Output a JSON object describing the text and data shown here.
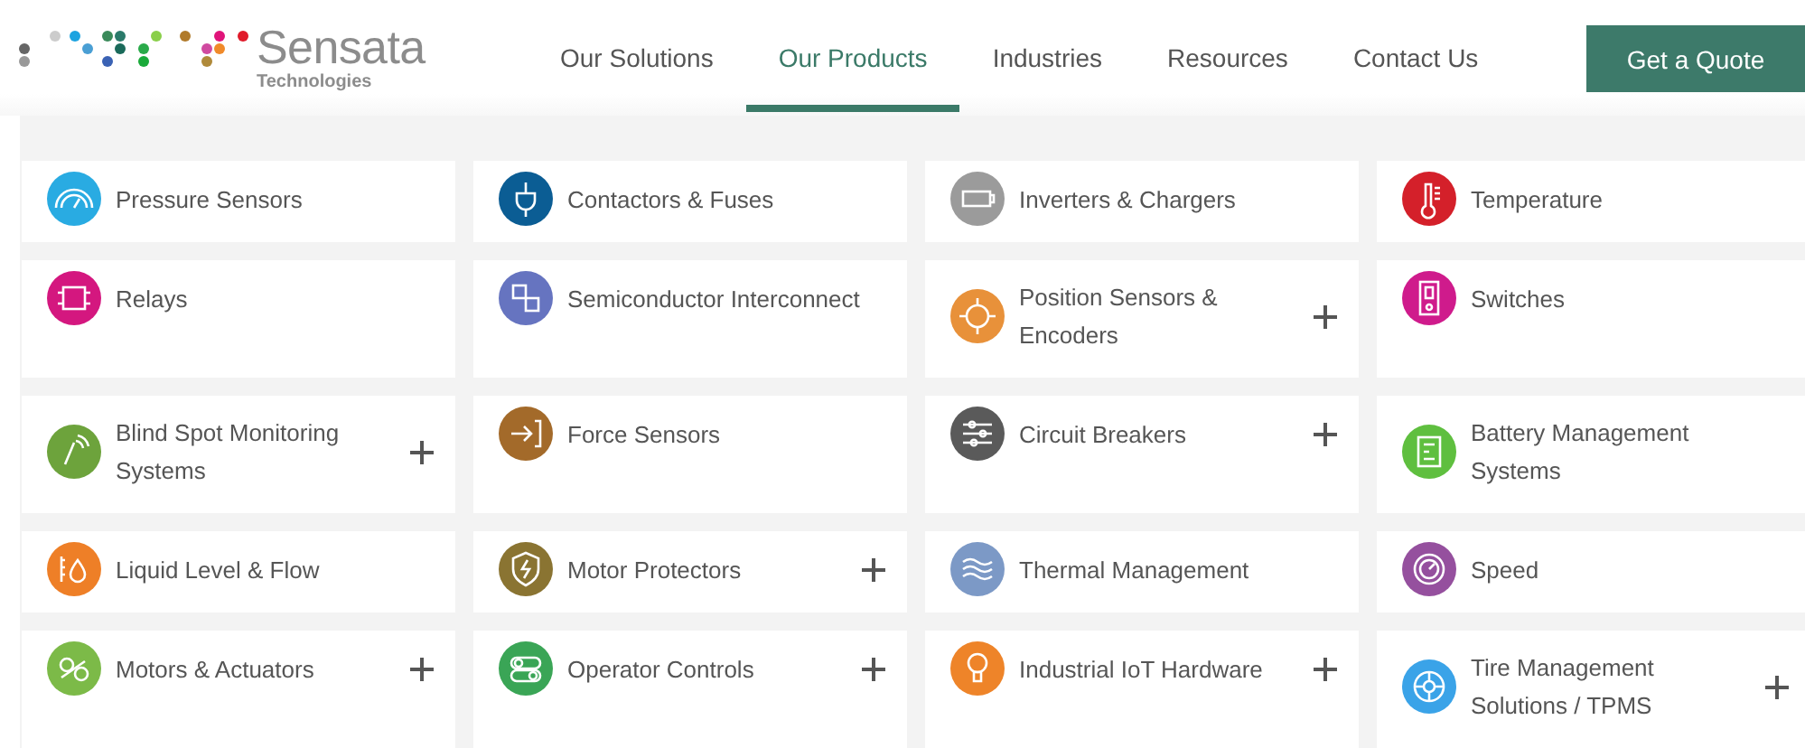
{
  "logo": {
    "name": "Sensata",
    "subtitle": "Technologies"
  },
  "nav": [
    {
      "label": "Our Solutions",
      "selected": false
    },
    {
      "label": "Our Products",
      "selected": true
    },
    {
      "label": "Industries",
      "selected": false
    },
    {
      "label": "Resources",
      "selected": false
    },
    {
      "label": "Contact Us",
      "selected": false
    }
  ],
  "quote_button": "Get a Quote",
  "categories": [
    {
      "label": "Pressure Sensors",
      "color": "#29abe2",
      "expandable": false
    },
    {
      "label": "Contactors & Fuses",
      "color": "#0b5d94",
      "expandable": false
    },
    {
      "label": "Inverters & Chargers",
      "color": "#9b9b9b",
      "expandable": false
    },
    {
      "label": "Temperature",
      "color": "#d4202a",
      "expandable": false
    },
    {
      "label": "Relays",
      "color": "#d4177f",
      "expandable": false
    },
    {
      "label": "Semiconductor Interconnect",
      "color": "#6674c0",
      "expandable": false
    },
    {
      "label": "Position Sensors & Encoders",
      "color": "#e8913a",
      "expandable": true
    },
    {
      "label": "Switches",
      "color": "#cf1b8c",
      "expandable": false
    },
    {
      "label": "Blind Spot Monitoring Systems",
      "color": "#6da33c",
      "expandable": true
    },
    {
      "label": "Force Sensors",
      "color": "#a36a2a",
      "expandable": false
    },
    {
      "label": "Circuit Breakers",
      "color": "#5a5a5a",
      "expandable": true
    },
    {
      "label": "Battery Management Systems",
      "color": "#5fbf3f",
      "expandable": false
    },
    {
      "label": "Liquid Level & Flow",
      "color": "#ee7f27",
      "expandable": false
    },
    {
      "label": "Motor Protectors",
      "color": "#8a7432",
      "expandable": true
    },
    {
      "label": "Thermal Management",
      "color": "#7c99c6",
      "expandable": false
    },
    {
      "label": "Speed",
      "color": "#95509e",
      "expandable": false
    },
    {
      "label": "Motors & Actuators",
      "color": "#7cba48",
      "expandable": true
    },
    {
      "label": "Operator Controls",
      "color": "#3aa556",
      "expandable": true
    },
    {
      "label": "Industrial IoT Hardware",
      "color": "#ee8429",
      "expandable": true
    },
    {
      "label": "Tire Management Solutions / TPMS",
      "color": "#3aa3e8",
      "expandable": true
    }
  ]
}
